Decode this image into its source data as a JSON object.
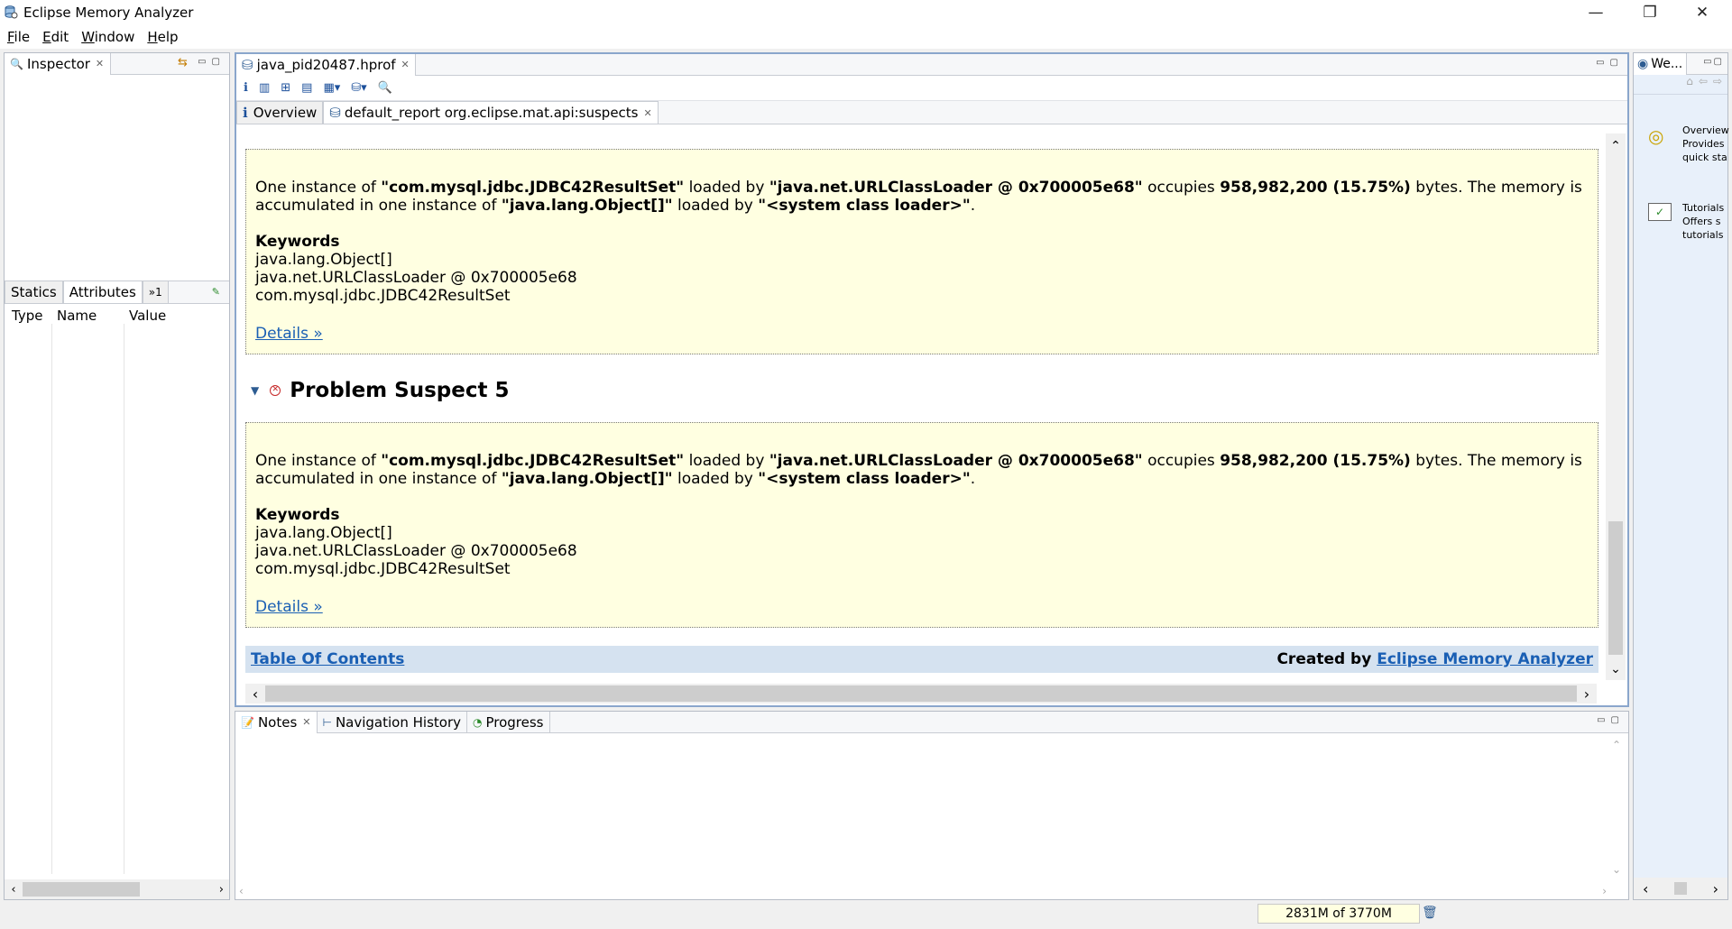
{
  "window": {
    "title": "Eclipse Memory Analyzer",
    "minimize": "—",
    "restore": "❐",
    "close": "✕"
  },
  "menu": [
    "File",
    "Edit",
    "Window",
    "Help"
  ],
  "inspector": {
    "tab": "Inspector",
    "tabs": [
      "Statics",
      "Attributes",
      "»1"
    ],
    "columns": [
      "Type",
      "Name",
      "Value"
    ]
  },
  "editor": {
    "file_tab": "java_pid20487.hprof",
    "subtabs": [
      "Overview",
      "default_report  org.eclipse.mat.api:suspects"
    ],
    "suspects": [
      {
        "heading": "",
        "t1": "One instance of ",
        "cls": "\"com.mysql.jdbc.JDBC42ResultSet\"",
        "t2": " loaded by ",
        "loader": "\"java.net.URLClassLoader @ 0x700005e68\"",
        "t3": " occupies ",
        "size": "958,982,200 (15.75%)",
        "t4": " bytes. The memory is accumulated in one instance of ",
        "acc": "\"java.lang.Object[]\"",
        "t5": " loaded by ",
        "sysloader": "\"<system class loader>\"",
        "t6": ".",
        "kw_title": "Keywords",
        "keywords": [
          "java.lang.Object[]",
          "java.net.URLClassLoader @ 0x700005e68",
          "com.mysql.jdbc.JDBC42ResultSet"
        ],
        "details": "Details »"
      },
      {
        "heading": "Problem Suspect 5",
        "t1": "One instance of ",
        "cls": "\"com.mysql.jdbc.JDBC42ResultSet\"",
        "t2": " loaded by ",
        "loader": "\"java.net.URLClassLoader @ 0x700005e68\"",
        "t3": " occupies ",
        "size": "958,982,200 (15.75%)",
        "t4": " bytes. The memory is accumulated in one instance of ",
        "acc": "\"java.lang.Object[]\"",
        "t5": " loaded by ",
        "sysloader": "\"<system class loader>\"",
        "t6": ".",
        "kw_title": "Keywords",
        "keywords": [
          "java.lang.Object[]",
          "java.net.URLClassLoader @ 0x700005e68",
          "com.mysql.jdbc.JDBC42ResultSet"
        ],
        "details": "Details »"
      }
    ],
    "footer": {
      "toc": "Table Of Contents",
      "created_by": "Created by ",
      "mat": "Eclipse Memory Analyzer"
    }
  },
  "bottom_tabs": [
    "Notes",
    "Navigation History",
    "Progress"
  ],
  "welcome": {
    "tab": "We...",
    "items": [
      {
        "t1": "Overview",
        "t2": "Provides",
        "t3": "quick sta"
      },
      {
        "t1": "Tutorials",
        "t2": "Offers s",
        "t3": "tutorials"
      }
    ]
  },
  "status": {
    "heap": "2831M of 3770M"
  }
}
